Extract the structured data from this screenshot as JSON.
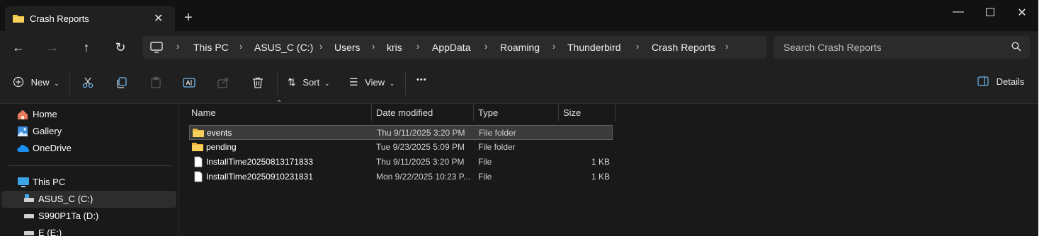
{
  "tab": {
    "title": "Crash Reports",
    "close": "✕",
    "new_tab": "+"
  },
  "window_controls": {
    "minimize": "—",
    "maximize": "☐",
    "close": "✕"
  },
  "breadcrumbs": [
    "This PC",
    "ASUS_C (C:)",
    "Users",
    "kris",
    "AppData",
    "Roaming",
    "Thunderbird",
    "Crash Reports"
  ],
  "search": {
    "placeholder": "Search Crash Reports"
  },
  "toolbar": {
    "new_label": "New",
    "sort_label": "Sort",
    "view_label": "View",
    "more": "•••",
    "details_label": "Details"
  },
  "sidebar": {
    "items": [
      {
        "label": "Home",
        "icon": "home-icon"
      },
      {
        "label": "Gallery",
        "icon": "gallery-icon"
      },
      {
        "label": "OneDrive",
        "icon": "onedrive-icon"
      },
      {
        "label": "This PC",
        "icon": "this-pc-icon"
      },
      {
        "label": "ASUS_C (C:)",
        "icon": "drive-icon",
        "selected": true
      },
      {
        "label": "S990P1Ta (D:)",
        "icon": "drive-icon"
      },
      {
        "label": "E (E:)",
        "icon": "drive-icon"
      }
    ]
  },
  "columns": {
    "name": "Name",
    "date": "Date modified",
    "type": "Type",
    "size": "Size"
  },
  "files": [
    {
      "name": "events",
      "date": "Thu 9/11/2025 3:20 PM",
      "type": "File folder",
      "size": "",
      "icon": "folder-icon",
      "selected": true
    },
    {
      "name": "pending",
      "date": "Tue 9/23/2025 5:09 PM",
      "type": "File folder",
      "size": "",
      "icon": "folder-icon"
    },
    {
      "name": "InstallTime20250813171833",
      "date": "Thu 9/11/2025 3:20 PM",
      "type": "File",
      "size": "1 KB",
      "icon": "file-icon"
    },
    {
      "name": "InstallTime20250910231831",
      "date": "Mon 9/22/2025 10:23 P...",
      "type": "File",
      "size": "1 KB",
      "icon": "file-icon"
    }
  ],
  "colors": {
    "window_bg": "#191919",
    "titlebar": "#121212",
    "accent": "#0078d4",
    "folder": "#f4c74a"
  }
}
